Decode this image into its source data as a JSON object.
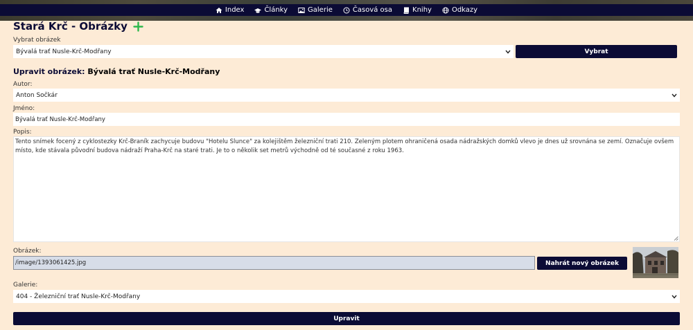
{
  "nav": {
    "items": [
      {
        "label": "Index",
        "icon": "home-icon"
      },
      {
        "label": "Články",
        "icon": "graduation-cap-icon"
      },
      {
        "label": "Galerie",
        "icon": "image-icon"
      },
      {
        "label": "Časová osa",
        "icon": "history-clock-icon"
      },
      {
        "label": "Knihy",
        "icon": "book-icon"
      },
      {
        "label": "Odkazy",
        "icon": "globe-icon"
      }
    ]
  },
  "page": {
    "title": "Stará Krč - Obrázky",
    "add_icon": "plus-icon"
  },
  "select_image": {
    "label": "Vybrat obrázek",
    "value": "Bývalá trať Nusle-Krč-Modřany",
    "button": "Vybrat"
  },
  "edit": {
    "heading_prefix": "Upravit obrázek:",
    "heading_item": "Bývalá trať Nusle-Krč-Modřany",
    "author_label": "Autor:",
    "author_value": "Anton Sočkár",
    "name_label": "Jméno:",
    "name_value": "Bývalá trať Nusle-Krč-Modřany",
    "desc_label": "Popis:",
    "desc_value": "Tento snímek focený z cyklostezky Krč-Braník zachycuje budovu \"Hotelu Slunce\" za kolejištěm železniční trati 210. Zeleným plotem ohraničená osada nádražských domků vlevo je dnes už srovnána se zemí. Označuje ovšem místo, kde stávala původní budova nádraží Praha-Krč na staré trati. Je to o několik set metrů východně od té současné z roku 1963.",
    "image_label": "Obrázek:",
    "image_path": "/image/1393061425.jpg",
    "upload_button": "Nahrát nový obrázek",
    "gallery_label": "Galerie:",
    "gallery_value": "404 - Železniční trať Nusle-Krč-Modřany",
    "submit_button": "Upravit"
  },
  "colors": {
    "background": "#fdebd6",
    "navy": "#0b0b35",
    "accent_green": "#2db84b"
  }
}
